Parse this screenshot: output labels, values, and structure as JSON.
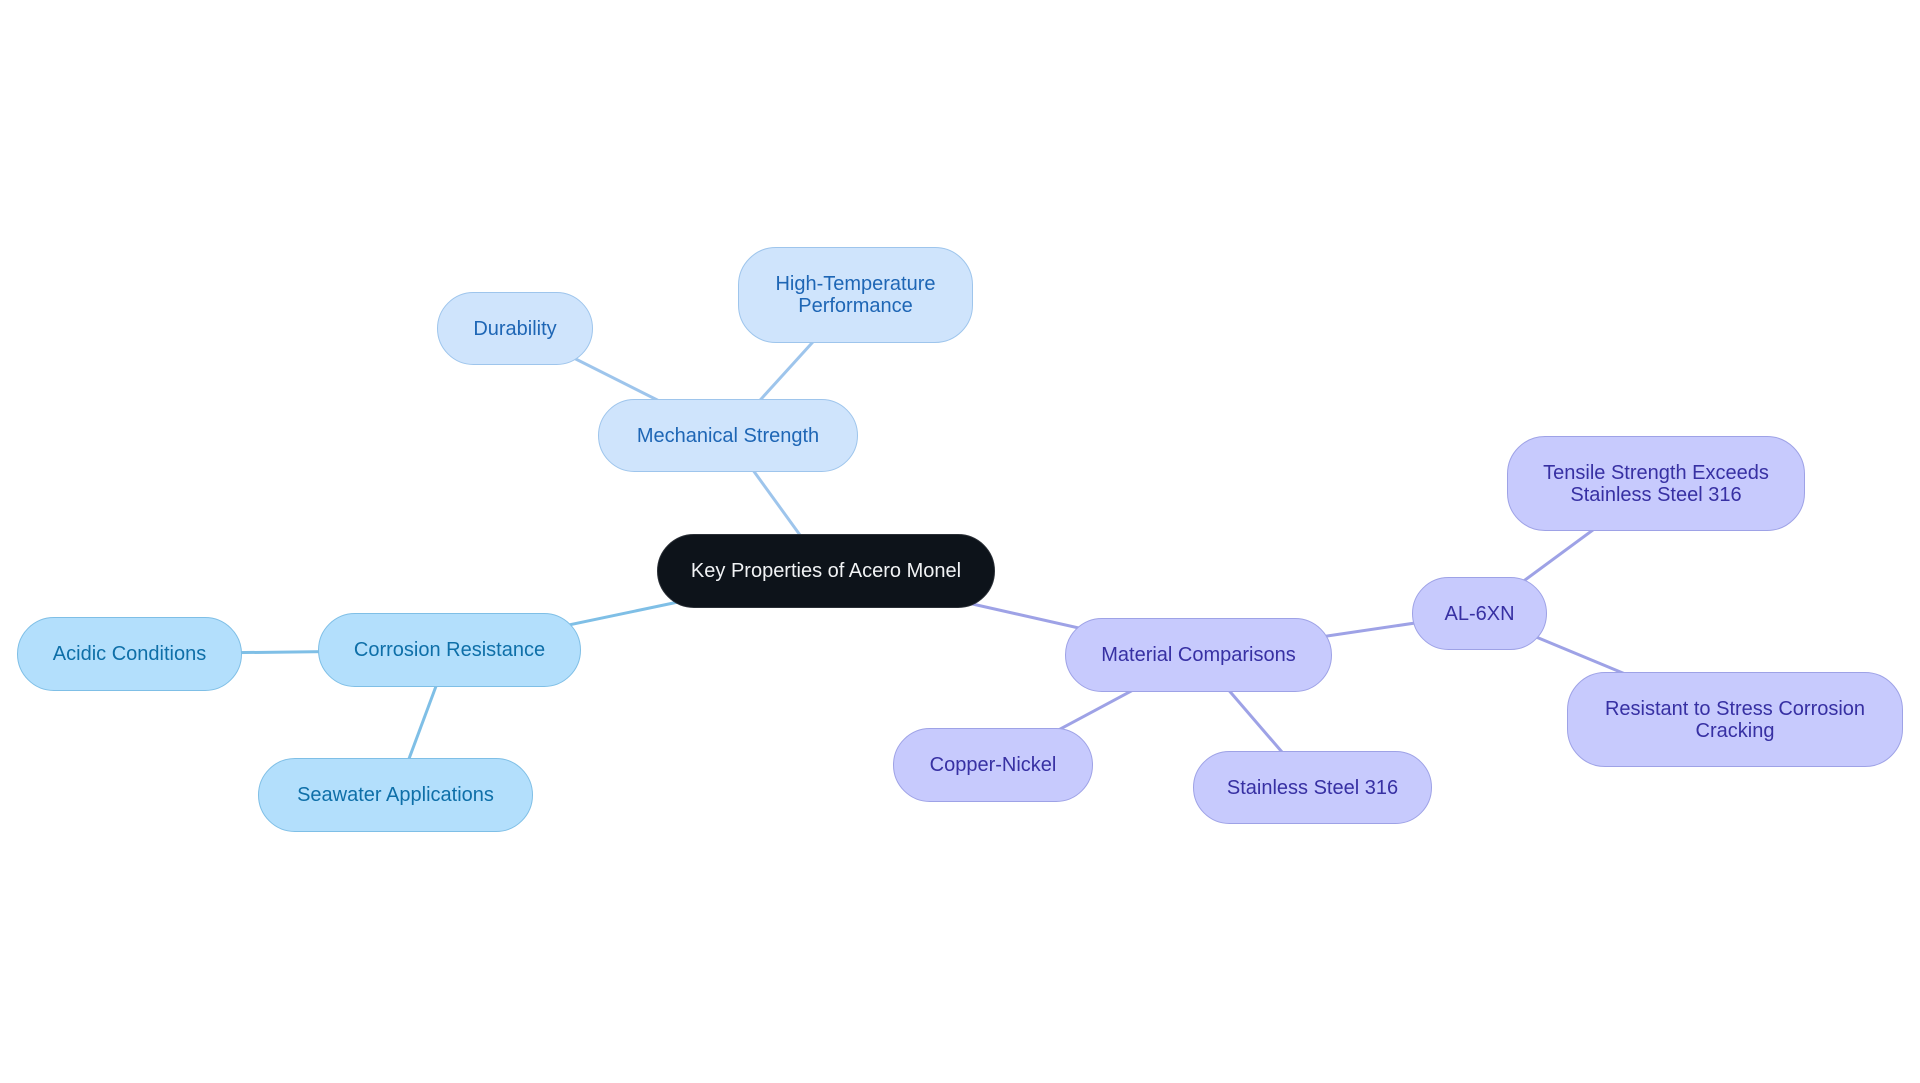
{
  "diagram": {
    "type": "mind-map",
    "root": {
      "id": "root",
      "label": "Key Properties of Acero Monel"
    },
    "colors": {
      "root_fill": "#0d131a",
      "root_text": "#f1f3f5",
      "mechanical_fill": "#cfe4fc",
      "mechanical_text": "#1e66b5",
      "mechanical_edge": "#9ec5ec",
      "corrosion_fill": "#b3dffc",
      "corrosion_text": "#0e6fa8",
      "corrosion_edge": "#7fbfe6",
      "materials_fill": "#c7cafd",
      "materials_text": "#3730a3",
      "materials_edge": "#9ea2e6"
    },
    "nodes": {
      "mechanical": {
        "label": "Mechanical Strength"
      },
      "durability": {
        "label": "Durability"
      },
      "high_temp": {
        "label": "High-Temperature\nPerformance"
      },
      "corrosion": {
        "label": "Corrosion Resistance"
      },
      "acidic": {
        "label": "Acidic Conditions"
      },
      "seawater": {
        "label": "Seawater Applications"
      },
      "materials": {
        "label": "Material Comparisons"
      },
      "copper_nickel": {
        "label": "Copper-Nickel"
      },
      "ss316": {
        "label": "Stainless Steel 316"
      },
      "al6xn": {
        "label": "AL-6XN"
      },
      "tensile": {
        "label": "Tensile Strength Exceeds\nStainless Steel 316"
      },
      "scc": {
        "label": "Resistant to Stress Corrosion\nCracking"
      }
    },
    "edges": [
      {
        "from": "root",
        "to": "mechanical",
        "branch": "mechanical"
      },
      {
        "from": "mechanical",
        "to": "durability",
        "branch": "mechanical"
      },
      {
        "from": "mechanical",
        "to": "high_temp",
        "branch": "mechanical"
      },
      {
        "from": "root",
        "to": "corrosion",
        "branch": "corrosion"
      },
      {
        "from": "corrosion",
        "to": "acidic",
        "branch": "corrosion"
      },
      {
        "from": "corrosion",
        "to": "seawater",
        "branch": "corrosion"
      },
      {
        "from": "root",
        "to": "materials",
        "branch": "materials"
      },
      {
        "from": "materials",
        "to": "copper_nickel",
        "branch": "materials"
      },
      {
        "from": "materials",
        "to": "ss316",
        "branch": "materials"
      },
      {
        "from": "materials",
        "to": "al6xn",
        "branch": "materials"
      },
      {
        "from": "al6xn",
        "to": "tensile",
        "branch": "materials"
      },
      {
        "from": "al6xn",
        "to": "scc",
        "branch": "materials"
      }
    ]
  }
}
